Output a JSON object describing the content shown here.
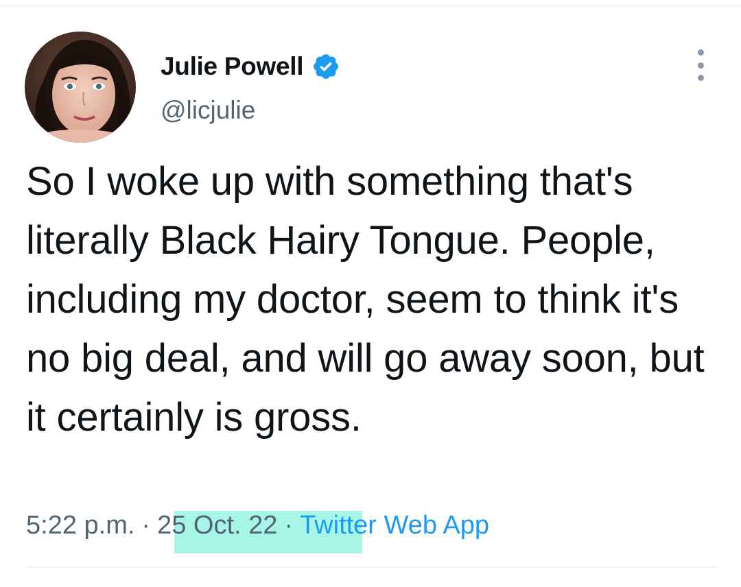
{
  "author": {
    "display_name": "Julie Powell",
    "handle": "@licjulie",
    "verified": true,
    "verified_color": "#1d9bf0"
  },
  "tweet": {
    "text": "So I woke up with something that's literally Black Hairy Tongue. People, including my doctor, seem to think it's no big deal, and will go away soon, but it certainly is gross."
  },
  "meta": {
    "time": "5:22 p.m.",
    "separator": "·",
    "date": "25 Oct. 22",
    "source": "Twitter Web App"
  },
  "icons": {
    "verified": "verified-badge-icon",
    "more": "more-options-icon"
  },
  "colors": {
    "text_primary": "#0f1419",
    "text_secondary": "#536471",
    "link": "#1d9bf0",
    "highlight": "#a6f5e7"
  }
}
